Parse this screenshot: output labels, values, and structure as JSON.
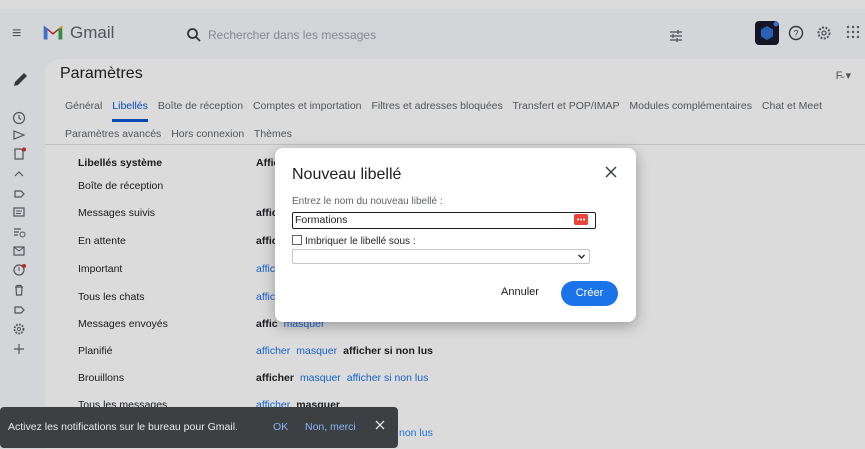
{
  "app": {
    "brand": "Gmail"
  },
  "search": {
    "placeholder": "Rechercher dans les messages"
  },
  "settings": {
    "title": "Paramètres",
    "lang_badge": "F̵ ▾",
    "tabs_row1": [
      "Général",
      "Libellés",
      "Boîte de réception",
      "Comptes et importation",
      "Filtres et adresses bloquées",
      "Transfert et POP/IMAP",
      "Modules complémentaires",
      "Chat et Meet"
    ],
    "tabs_row2": [
      "Paramètres avancés",
      "Hors connexion",
      "Thèmes"
    ],
    "active_tab": "Libellés",
    "section_header": "Libellés système",
    "col_header": "Affic",
    "rows": [
      {
        "name": "Boîte de réception"
      },
      {
        "name": "Messages suivis",
        "c1": "affic"
      },
      {
        "name": "En attente",
        "c1": "affic"
      },
      {
        "name": "Important",
        "c1": "affic"
      },
      {
        "name": "Tous les chats",
        "c1": "affic"
      },
      {
        "name": "Messages envoyés",
        "c1": "affic",
        "c2": "masquer"
      },
      {
        "name": "Planifié",
        "c1": "afficher",
        "c2": "masquer",
        "c3": "afficher si non lus"
      },
      {
        "name": "Brouillons",
        "c1": "afficher",
        "c2": "masquer",
        "c3": "afficher si non lus"
      },
      {
        "name": "Tous les messages",
        "c1": "afficher",
        "c2": "masquer"
      }
    ]
  },
  "dialog": {
    "title": "Nouveau libellé",
    "name_label": "Entrez le nom du nouveau libellé :",
    "name_value": "Formations",
    "nest_label": "Imbriquer le libellé sous :",
    "cancel_label": "Annuler",
    "create_label": "Créer"
  },
  "snackbar": {
    "message": "Activez les notifications sur le bureau pour Gmail.",
    "ok_label": "OK",
    "no_label": "Non, merci",
    "tail": "non lus"
  },
  "colors": {
    "accent": "#1a73e8",
    "dialog_bg": "#ffffff",
    "snack_bg": "#3c4043"
  }
}
